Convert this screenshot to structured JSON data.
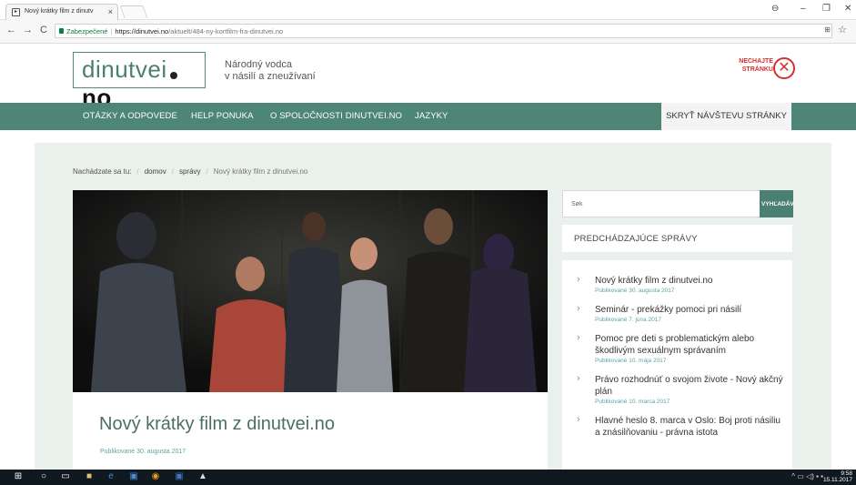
{
  "browser": {
    "tab_title": "Nový krátky film z dinutv",
    "address": {
      "secure_label": "Zabezpečené",
      "host": "https://dinutvei.no",
      "path": "/aktuelt/484-ny-kortfilm-fra-dinutvei.no"
    }
  },
  "header": {
    "logo_main": "dinutvei",
    "logo_tld": "no",
    "tagline_line1": "Národný vodca",
    "tagline_line2": "v násilí a zneužívaní",
    "exit_line1": "NECHAJTE",
    "exit_line2": "STRÁNKU"
  },
  "nav": {
    "items": [
      "OTÁZKY A ODPOVEDE",
      "HELP PONUKA",
      "O SPOLOČNOSTI DINUTVEI.NO",
      "JAZYKY"
    ],
    "hide_visit": "SKRYŤ NÁVŠTEVU STRÁNKY"
  },
  "breadcrumb": {
    "label": "Nachádzate sa tu:",
    "home": "domov",
    "section": "správy",
    "current": "Nový krátky film z dinutvei.no"
  },
  "article": {
    "title": "Nový krátky film z dinutvei.no",
    "date": "Publikované 30. augusta 2017"
  },
  "sidebar": {
    "search_placeholder": "Søk",
    "search_button": "VYHĽADÁVANIE",
    "news_header": "PREDCHÁDZAJÚCE SPRÁVY",
    "news": [
      {
        "title": "Nový krátky film z dinutvei.no",
        "date": "Publikované 30. augusta 2017"
      },
      {
        "title": "Seminár - prekážky pomoci pri násilí",
        "date": "Publikované 7. júna 2017"
      },
      {
        "title": "Pomoc pre deti s problematickým alebo škodlivým sexuálnym správaním",
        "date": "Publikované 10. mája 2017"
      },
      {
        "title": "Právo rozhodnúť o svojom živote - Nový akčný plán",
        "date": "Publikované 10. marca 2017"
      },
      {
        "title": "Hlavné heslo 8. marca v Oslo: Boj proti násiliu a znásilňovaniu - právna istota",
        "date": ""
      }
    ]
  },
  "taskbar": {
    "time": "9:58",
    "date": "15.11.2017"
  }
}
